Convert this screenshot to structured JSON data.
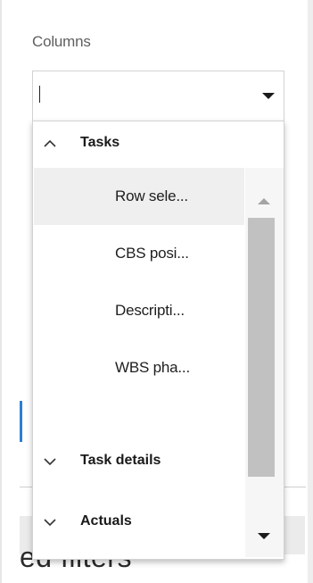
{
  "columns_field": {
    "label": "Columns",
    "value": "",
    "placeholder": ""
  },
  "background": {
    "partial_text": "ed filters"
  },
  "column_groups": [
    {
      "label": "Tasks",
      "expanded": true,
      "items": [
        {
          "label": "Row sele...",
          "selected": true
        },
        {
          "label": "CBS posi...",
          "selected": false
        },
        {
          "label": "Descripti...",
          "selected": false
        },
        {
          "label": "WBS pha...",
          "selected": false
        }
      ]
    },
    {
      "label": "Task details",
      "expanded": false
    },
    {
      "label": "Actuals",
      "expanded": false
    }
  ],
  "icons": {
    "dropdown": "caret-down-icon",
    "expanded_group": "chevron-up-icon",
    "collapsed_group": "chevron-down-icon",
    "scroll_up": "scroll-up-arrow-icon",
    "scroll_down": "scroll-down-arrow-icon"
  },
  "colors": {
    "accent": "#2a7fd4",
    "selected_row": "#efefef",
    "scroll_thumb": "#c1c1c1"
  }
}
